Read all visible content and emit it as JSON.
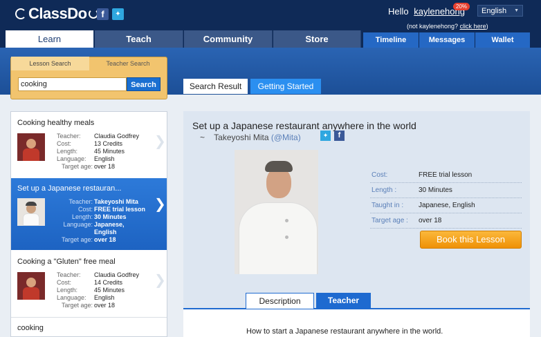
{
  "header": {
    "logo": "ClassDo",
    "greeting": "Hello",
    "username": "kaylenehong",
    "badge": "20%",
    "not_user_prefix": "(not kaylenehong? ",
    "not_user_link": "click here",
    "not_user_suffix": ")",
    "language": "English"
  },
  "nav": {
    "tabs": [
      "Learn",
      "Teach",
      "Community",
      "Store"
    ],
    "subtabs": [
      "Timeline",
      "Messages",
      "Wallet"
    ]
  },
  "search": {
    "tabs": [
      "Lesson Search",
      "Teacher Search"
    ],
    "query": "cooking",
    "button": "Search",
    "result_tabs": [
      "Search Result",
      "Getting Started"
    ]
  },
  "list": {
    "labels": {
      "teacher": "Teacher:",
      "cost": "Cost:",
      "length": "Length:",
      "language": "Language:",
      "target": "Target age:"
    },
    "items": [
      {
        "title": "Cooking healthy meals",
        "teacher": "Claudia Godfrey",
        "cost": "13 Credits",
        "length": "45 Minutes",
        "language": "English",
        "target": "over 18"
      },
      {
        "title": "Set up a Japanese restauran...",
        "teacher": "Takeyoshi Mita",
        "cost": "FREE trial lesson",
        "length": "30 Minutes",
        "language": "Japanese,",
        "language2": "English",
        "target": "over 18"
      },
      {
        "title": "Cooking a \"Gluten\" free meal",
        "teacher": "Claudia Godfrey",
        "cost": "14 Credits",
        "length": "45 Minutes",
        "language": "English",
        "target": "over 18"
      },
      {
        "title": "cooking"
      }
    ]
  },
  "detail": {
    "title": "Set up a Japanese restaurant anywhere in the world",
    "teacher_prefix": "~",
    "teacher_name": "Takeyoshi Mita",
    "teacher_handle": "(@Mita)",
    "rows": [
      {
        "label": "Cost:",
        "value": "FREE trial lesson"
      },
      {
        "label": "Length :",
        "value": "30 Minutes"
      },
      {
        "label": "Taught in :",
        "value": "Japanese, English"
      },
      {
        "label": "Target age :",
        "value": "over 18"
      }
    ],
    "book_button": "Book this Lesson",
    "tabs": [
      "Description",
      "Teacher"
    ],
    "description": "How to start a Japanese restaurant anywhere in the world."
  },
  "colors": {
    "header_bg": "#0f2a57",
    "accent": "#1e6ad0",
    "book": "#f7a316"
  }
}
